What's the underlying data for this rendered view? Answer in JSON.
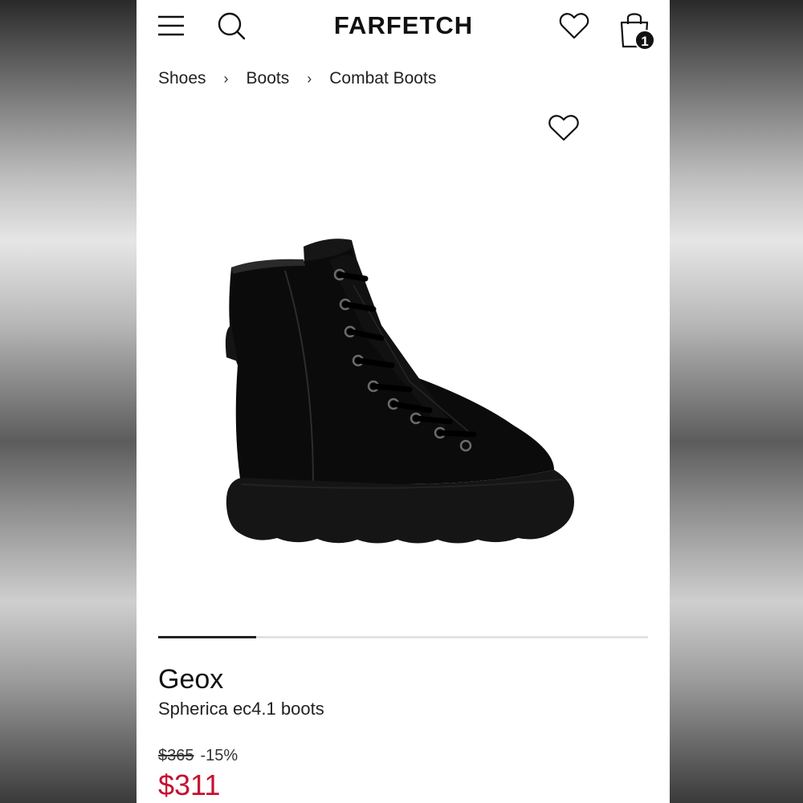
{
  "header": {
    "logo": "FARFETCH",
    "bag_count": "1"
  },
  "breadcrumb": {
    "items": [
      "Shoes",
      "Boots",
      "Combat Boots"
    ],
    "separator": "›"
  },
  "gallery": {
    "progress": 0.2
  },
  "product": {
    "brand": "Geox",
    "name": "Spherica ec4.1 boots",
    "original_price": "$365",
    "discount": "-15%",
    "price": "$311"
  },
  "colors": {
    "sale_price": "#c4112f",
    "text": "#111111"
  }
}
